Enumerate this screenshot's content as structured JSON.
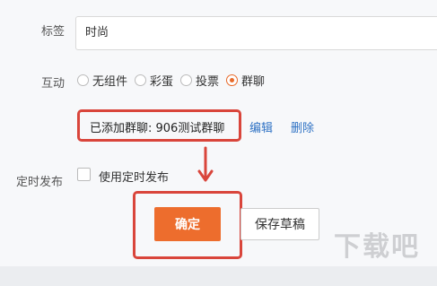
{
  "form": {
    "tag_label": "标签",
    "tag_value": "时尚",
    "interact_label": "互动",
    "interact_options": [
      {
        "label": "无组件",
        "checked": false
      },
      {
        "label": "彩蛋",
        "checked": false
      },
      {
        "label": "投票",
        "checked": false
      },
      {
        "label": "群聊",
        "checked": true
      }
    ],
    "added_group_text": "已添加群聊: 906测试群聊",
    "edit_link": "编辑",
    "delete_link": "删除",
    "schedule_label": "定时发布",
    "schedule_checkbox_label": "使用定时发布",
    "schedule_checked": false
  },
  "actions": {
    "confirm_label": "确定",
    "save_draft_label": "保存草稿"
  },
  "watermark": {
    "text": "下载吧"
  },
  "colors": {
    "accent": "#ed6d2d",
    "highlight": "#d9453b",
    "link": "#2f72c4"
  }
}
